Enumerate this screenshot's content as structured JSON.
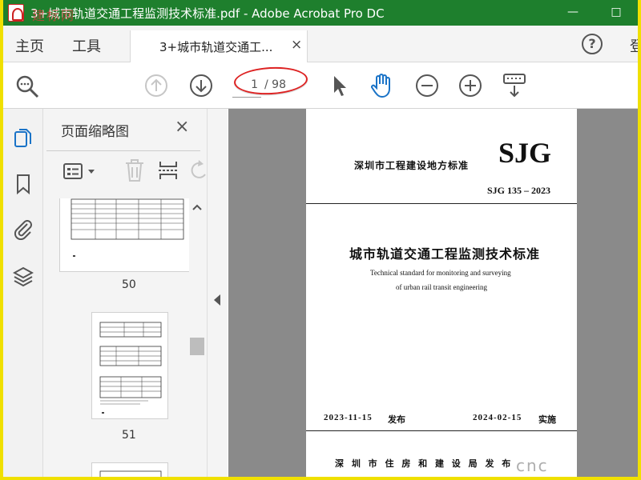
{
  "window": {
    "title": "3+城市轨道交通工程监测技术标准.pdf - Adobe Acrobat Pro DC",
    "watermark": "建标网",
    "minimize": "—",
    "maximize": "□"
  },
  "tabs": {
    "home": "主页",
    "tools": "工具",
    "document": "3+城市轨道交通工...",
    "close": "×",
    "help": "?",
    "login": "登"
  },
  "toolbar": {
    "current_page": "1",
    "total_pages": "/ 98"
  },
  "panel": {
    "title": "页面缩略图",
    "close": "×",
    "thumbnails": [
      {
        "label": "50"
      },
      {
        "label": "51"
      }
    ]
  },
  "document": {
    "org": "深圳市工程建设地方标准",
    "logo": "SJG",
    "code": "SJG 135 – 2023",
    "title_cn": "城市轨道交通工程监测技术标准",
    "title_en_1": "Technical standard for monitoring and surveying",
    "title_en_2": "of urban rail transit engineering",
    "issue_date": "2023-11-15",
    "issue_label": "发布",
    "impl_date": "2024-02-15",
    "impl_label": "实施",
    "publisher": "深 圳 市 住 房 和 建 设 局 发 布"
  },
  "site_watermark": "cnc",
  "colors": {
    "titlebar": "#1e7f2d",
    "accent_blue": "#1a73c7",
    "highlight_red": "#d22222",
    "frame_yellow": "#f0e000"
  }
}
